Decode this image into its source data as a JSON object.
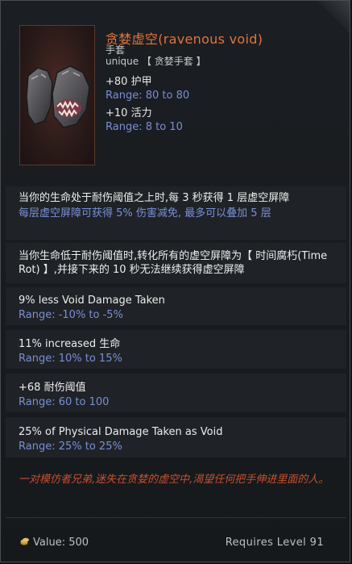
{
  "item": {
    "name": "贪婪虚空(ravenous void)",
    "type": "手套",
    "rarity": "unique 【 贪婪手套 】",
    "stats": [
      {
        "label": "+80 护甲",
        "range": "Range: 80 to 80"
      },
      {
        "label": "+10 活力",
        "range": "Range: 8 to 10"
      }
    ]
  },
  "mods": [
    {
      "text": "当你的生命处于耐伤阈值之上时,每 3 秒获得 1 层虚空屏障",
      "sub": "每层虚空屏障可获得 5% 伤害减免, 最多可以叠加 5 层"
    },
    {
      "text": "当你生命低于耐伤阈值时,转化所有的虚空屏障为【 时间腐朽(Time Rot) 】,并接下来的 10 秒无法继续获得虚空屏障",
      "sub": ""
    },
    {
      "text": "9% less Void Damage Taken",
      "sub": "Range: -10% to -5%"
    },
    {
      "text": "11% increased 生命",
      "sub": "Range: 10% to 15%"
    },
    {
      "text": "+68 耐伤阈值",
      "sub": "Range: 60 to 100"
    },
    {
      "text": "25% of Physical Damage Taken as Void",
      "sub": "Range: 25% to 25%"
    }
  ],
  "lore": "一对模仿者兄弟,迷失在贪婪的虚空中,渴望任何把手伸进里面的人。",
  "footer": {
    "value": "Value: 500",
    "requires": "Requires Level 91"
  },
  "colors": {
    "name": "#e2743c",
    "range": "#7a8fd6",
    "lore": "#c7502e"
  },
  "icons": [
    "gloves-item-icon",
    "coin-icon"
  ]
}
